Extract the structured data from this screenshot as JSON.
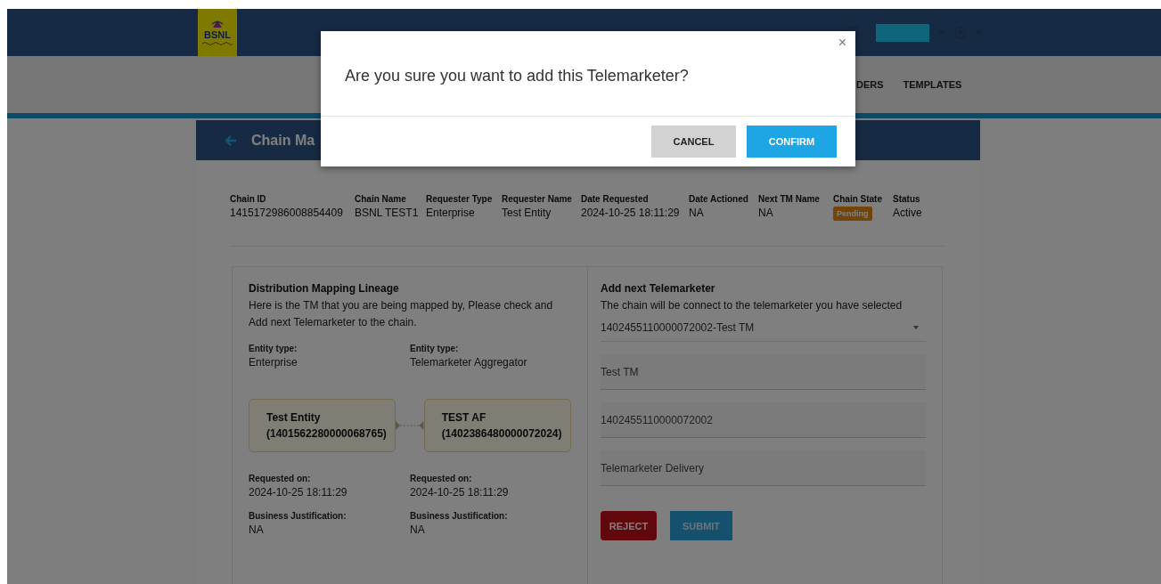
{
  "header": {
    "logo": "BSNL"
  },
  "nav": [
    {
      "label": "DERS"
    },
    {
      "label": "TEMPLATES"
    }
  ],
  "page_title": "Chain Ma",
  "info": [
    {
      "label": "Chain ID",
      "value": "1415172986008854409",
      "kind": "text"
    },
    {
      "label": "Chain Name",
      "value": "BSNL TEST1",
      "kind": "text"
    },
    {
      "label": "Requester Type",
      "value": "Enterprise",
      "kind": "text"
    },
    {
      "label": "Requester Name",
      "value": "Test Entity",
      "kind": "text"
    },
    {
      "label": "Date Requested",
      "value": "2024-10-25 18:11:29",
      "kind": "text"
    },
    {
      "label": "Date Actioned",
      "value": "NA",
      "kind": "text"
    },
    {
      "label": "Next TM Name",
      "value": "NA",
      "kind": "text"
    },
    {
      "label": "Chain State",
      "value": "Pending",
      "kind": "badge"
    },
    {
      "label": "Status",
      "value": "Active",
      "kind": "text"
    }
  ],
  "lineage": {
    "title": "Distribution Mapping Lineage",
    "description": "Here is the TM that you are being mapped by, Please check and Add next Telemarketer to the chain.",
    "nodes": [
      {
        "entity_type_label": "Entity type:",
        "entity_type": "Enterprise",
        "name": "Test Entity",
        "id": "(1401562280000068765)",
        "requested_label": "Requested on:",
        "requested_on": "2024-10-25 18:11:29",
        "justification_label": "Business Justification:",
        "justification": "NA"
      },
      {
        "entity_type_label": "Entity type:",
        "entity_type": "Telemarketer Aggregator",
        "name": "TEST AF",
        "id": "(1402386480000072024)",
        "requested_label": "Requested on:",
        "requested_on": "2024-10-25 18:11:29",
        "justification_label": "Business Justification:",
        "justification": "NA"
      }
    ]
  },
  "add_next": {
    "title": "Add next Telemarketer",
    "description": "The chain will be connect to the telemarketer you have selected",
    "select_value": "1402455110000072002-Test TM",
    "fields": [
      {
        "value": "Test TM"
      },
      {
        "value": "1402455110000072002"
      },
      {
        "value": "Telemarketer Delivery"
      }
    ],
    "buttons": [
      {
        "label": "REJECT",
        "kind": "danger"
      },
      {
        "label": "SUBMIT",
        "kind": "primary"
      }
    ]
  },
  "modal": {
    "question": "Are you sure you want to add this Telemarketer?",
    "close": "×",
    "buttons": [
      {
        "label": "CANCEL",
        "kind": "secondary"
      },
      {
        "label": "CONFIRM",
        "kind": "primary"
      }
    ]
  }
}
